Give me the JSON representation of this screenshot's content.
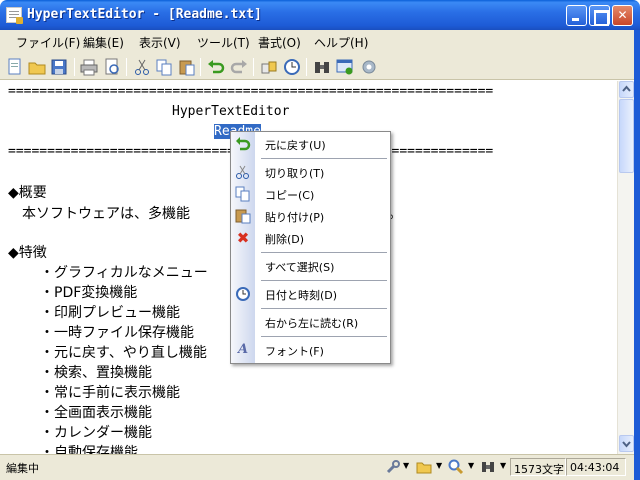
{
  "window": {
    "title": "HyperTextEditor - [Readme.txt]"
  },
  "menu": [
    "ファイル(F)",
    "編集(E)",
    "表示(V)",
    "ツール(T)",
    "書式(O)",
    "ヘルプ(H)"
  ],
  "toolbar": {
    "icons": [
      "new-file-icon",
      "open-folder-icon",
      "save-icon",
      "print-icon",
      "print-preview-icon",
      "cut-icon",
      "copy-icon",
      "paste-icon",
      "undo-icon",
      "redo-icon",
      "find-icon",
      "datetime-icon",
      "binoculars-icon",
      "fullscreen-icon",
      "help-icon"
    ]
  },
  "editor": {
    "rule": "==============================================================",
    "title": "HyperTextEditor",
    "subtitle": "Readme",
    "overview_heading": "◆概要",
    "overview_text": "　本ソフトウェアは、多機能",
    "overview_tail": "。",
    "features_heading": "◆特徴",
    "features": [
      "・グラフィカルなメニュー",
      "・PDF変換機能",
      "・印刷プレビュー機能",
      "・一時ファイル保存機能",
      "・元に戻す、やり直し機能",
      "・検索、置換機能",
      "・常に手前に表示機能",
      "・全画面表示機能",
      "・カレンダー機能",
      "・自動保存機能"
    ]
  },
  "context_menu": {
    "items": [
      {
        "label": "元に戻す(U)",
        "icon": "undo-icon"
      },
      {
        "label": "切り取り(T)",
        "icon": "cut-icon"
      },
      {
        "label": "コピー(C)",
        "icon": "copy-icon"
      },
      {
        "label": "貼り付け(P)",
        "icon": "paste-icon"
      },
      {
        "label": "削除(D)",
        "icon": "delete-icon"
      },
      {
        "label": "すべて選択(S)",
        "icon": ""
      },
      {
        "label": "日付と時刻(D)",
        "icon": "datetime-icon"
      },
      {
        "label": "右から左に読む(R)",
        "icon": ""
      },
      {
        "label": "フォント(F)",
        "icon": "font-icon"
      }
    ]
  },
  "statusbar": {
    "mode": "編集中",
    "char_count": "1573文字",
    "time": "04:43:04"
  },
  "colors": {
    "selection": "#316ac5",
    "titlebar": "#2a6fe6"
  }
}
